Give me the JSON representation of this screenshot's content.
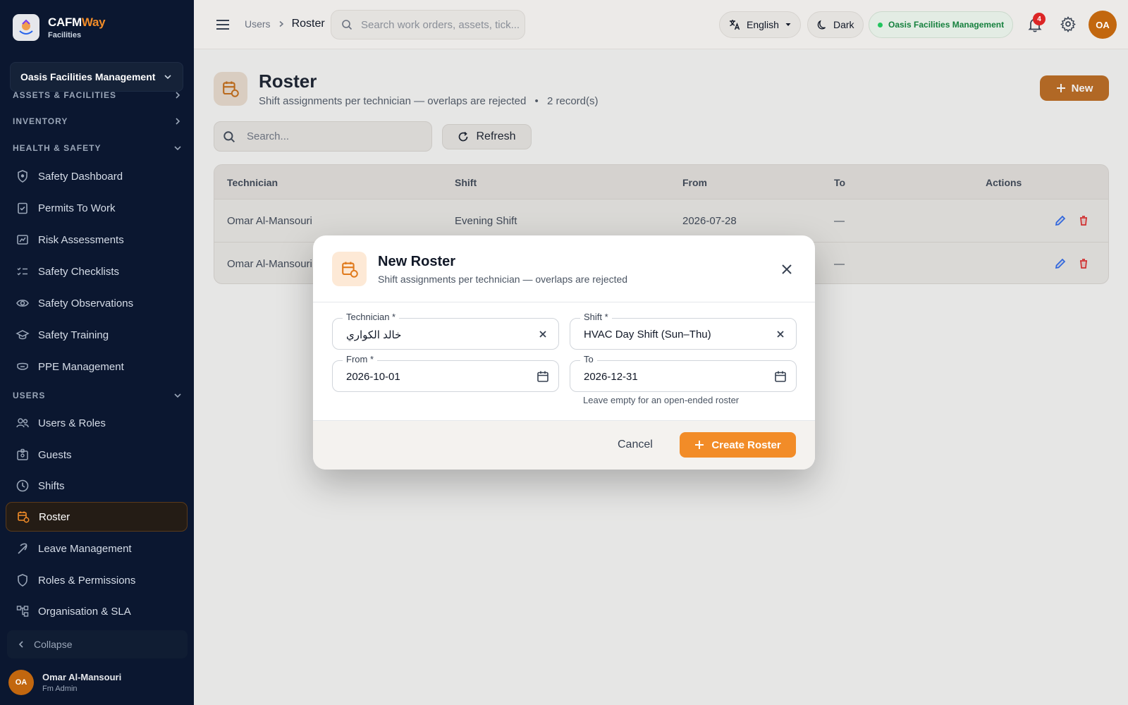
{
  "app": {
    "brand_main": "CAFM",
    "brand_accent": "Way",
    "brand_sub": "Facilities",
    "org": "Oasis Facilities Management"
  },
  "sidebar": {
    "sections": {
      "assets": "ASSETS & FACILITIES",
      "inventory": "INVENTORY",
      "health": "HEALTH & SAFETY",
      "users": "USERS"
    },
    "items": [
      {
        "label": "Safety Dashboard",
        "icon": "shield-icon"
      },
      {
        "label": "Permits To Work",
        "icon": "clipboard-check-icon"
      },
      {
        "label": "Risk Assessments",
        "icon": "risk-icon"
      },
      {
        "label": "Safety Checklists",
        "icon": "checklist-icon"
      },
      {
        "label": "Safety Observations",
        "icon": "eye-icon"
      },
      {
        "label": "Safety Training",
        "icon": "graduation-cap-icon"
      },
      {
        "label": "PPE Management",
        "icon": "mask-icon"
      },
      {
        "label": "Users & Roles",
        "icon": "users-icon"
      },
      {
        "label": "Guests",
        "icon": "badge-icon"
      },
      {
        "label": "Shifts",
        "icon": "clock-icon"
      },
      {
        "label": "Roster",
        "icon": "calendar-clock-icon"
      },
      {
        "label": "Leave Management",
        "icon": "leave-icon"
      },
      {
        "label": "Roles & Permissions",
        "icon": "shield-outline-icon"
      },
      {
        "label": "Organisation & SLA",
        "icon": "org-chart-icon"
      }
    ],
    "collapse": "Collapse",
    "user": {
      "initials": "OA",
      "name": "Omar Al-Mansouri",
      "role": "Fm Admin"
    }
  },
  "topbar": {
    "crumbs": [
      "Users",
      "Roster"
    ],
    "search_placeholder": "Search work orders, assets, tick...",
    "language": "English",
    "theme": "Dark",
    "org": "Oasis Facilities Management",
    "notifications": "4",
    "avatar": "OA"
  },
  "page": {
    "title": "Roster",
    "subtitle": "Shift assignments per technician — overlaps are rejected",
    "records": "2 record(s)",
    "new_label": "New",
    "search_placeholder": "Search...",
    "refresh_label": "Refresh"
  },
  "table": {
    "headers": [
      "Technician",
      "Shift",
      "From",
      "To",
      "Actions"
    ],
    "rows": [
      [
        "Omar Al-Mansouri",
        "Evening Shift",
        "2026-07-28",
        "—"
      ],
      [
        "Omar Al-Mansouri",
        "",
        "",
        "—"
      ]
    ]
  },
  "modal": {
    "title": "New Roster",
    "subtitle": "Shift assignments per technician — overlaps are rejected",
    "technician_label": "Technician *",
    "technician_value": "خالد الكواري",
    "shift_label": "Shift *",
    "shift_value": "HVAC Day Shift (Sun–Thu)",
    "from_label": "From *",
    "from_value": "2026-10-01",
    "to_label": "To",
    "to_value": "2026-12-31",
    "helper": "Leave empty for an open-ended roster",
    "cancel": "Cancel",
    "create": "Create Roster"
  },
  "colors": {
    "accent": "#f28c28",
    "sidebar": "#0b1730",
    "danger": "#dc2626",
    "edit": "#2563eb"
  }
}
